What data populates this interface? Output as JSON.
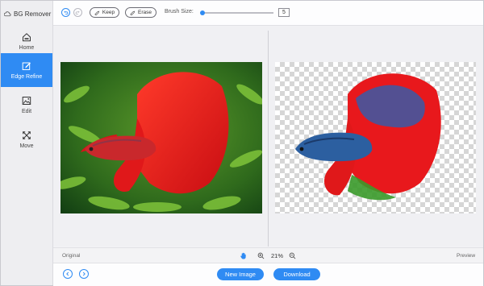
{
  "app": {
    "title": "BG Remover"
  },
  "sidebar": {
    "items": [
      {
        "label": "Home",
        "icon": "home-icon"
      },
      {
        "label": "Edge Refine",
        "icon": "edge-refine-icon",
        "active": true
      },
      {
        "label": "Edit",
        "icon": "image-edit-icon"
      },
      {
        "label": "Move",
        "icon": "move-icon"
      }
    ]
  },
  "toolbar": {
    "keep_label": "Keep",
    "erase_label": "Erase",
    "brush_label": "Brush Size:",
    "brush_size": "5",
    "brush_slider_fraction": 0.0
  },
  "canvas": {
    "original_label": "Original",
    "preview_label": "Preview",
    "zoom": "21%"
  },
  "bottom": {
    "new_image_label": "New Image",
    "download_label": "Download"
  },
  "colors": {
    "accent": "#2f8bf3",
    "fish_red": "#e31c1c",
    "fish_blue": "#2c5fa0"
  }
}
